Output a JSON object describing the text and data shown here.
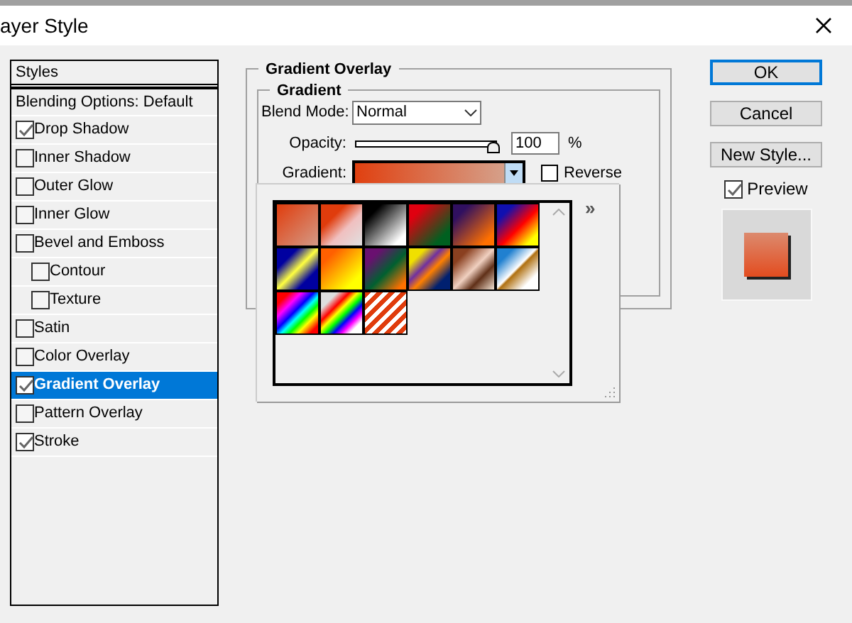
{
  "window": {
    "title": "ayer Style"
  },
  "styles_panel": {
    "header": "Styles",
    "items": [
      {
        "kind": "option",
        "label": "Blending Options: Default",
        "selected": false
      },
      {
        "kind": "effect",
        "label": "Drop Shadow",
        "checked": true,
        "selected": false
      },
      {
        "kind": "effect",
        "label": "Inner Shadow",
        "checked": false,
        "selected": false
      },
      {
        "kind": "effect",
        "label": "Outer Glow",
        "checked": false,
        "selected": false
      },
      {
        "kind": "effect",
        "label": "Inner Glow",
        "checked": false,
        "selected": false
      },
      {
        "kind": "effect",
        "label": "Bevel and Emboss",
        "checked": false,
        "selected": false,
        "children": [
          {
            "kind": "effect",
            "label": "Contour",
            "checked": false,
            "selected": false
          },
          {
            "kind": "effect",
            "label": "Texture",
            "checked": false,
            "selected": false
          }
        ]
      },
      {
        "kind": "effect",
        "label": "Satin",
        "checked": false,
        "selected": false
      },
      {
        "kind": "effect",
        "label": "Color Overlay",
        "checked": false,
        "selected": false
      },
      {
        "kind": "effect",
        "label": "Gradient Overlay",
        "checked": true,
        "selected": true
      },
      {
        "kind": "effect",
        "label": "Pattern Overlay",
        "checked": false,
        "selected": false
      },
      {
        "kind": "effect",
        "label": "Stroke",
        "checked": true,
        "selected": false
      }
    ]
  },
  "gradient_overlay": {
    "title": "Gradient Overlay",
    "group_title": "Gradient",
    "blend_mode": {
      "label": "Blend Mode:",
      "value": "Normal"
    },
    "opacity": {
      "label": "Opacity:",
      "level": 1,
      "value": "100",
      "unit": "%"
    },
    "gradient": {
      "label": "Gradient:",
      "reverse": {
        "label": "Reverse",
        "checked": false
      }
    },
    "picker": {
      "menu_label": "»"
    }
  },
  "buttons": [
    {
      "label": "OK",
      "default": true
    },
    {
      "label": "Cancel",
      "default": false
    },
    {
      "label": "New Style...",
      "default": false
    }
  ],
  "preview": {
    "label": "Preview",
    "checked": true
  }
}
